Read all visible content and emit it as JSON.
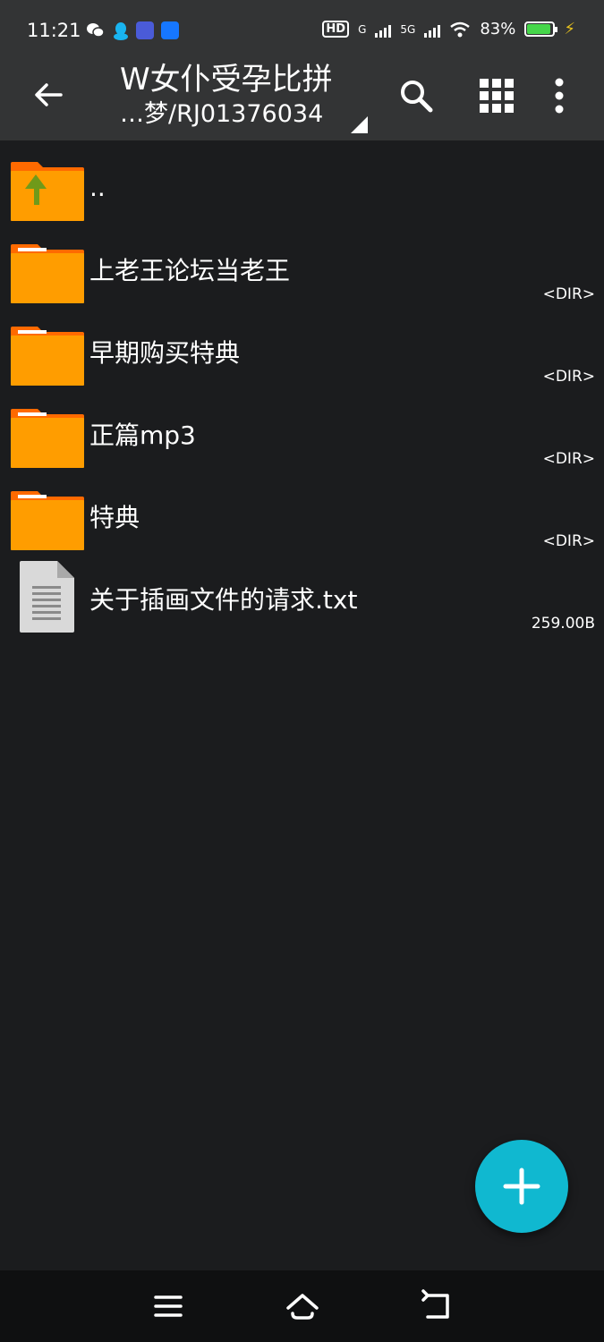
{
  "status_bar": {
    "time": "11:21",
    "right_text_hd": "HD",
    "network_a": "G",
    "network_b": "5G",
    "battery": "83%"
  },
  "toolbar": {
    "title": "W女仆受孕比拼",
    "subtitle": "…梦/RJ01376034"
  },
  "icons": {
    "back": "back-arrow-icon",
    "search": "search-icon",
    "grid": "grid-view-icon",
    "more": "more-vert-icon",
    "fab": "add-icon",
    "nav_menu": "menu-icon",
    "nav_home": "home-icon",
    "nav_back": "back-icon"
  },
  "colors": {
    "header": "#333435",
    "background": "#1b1c1e",
    "folder": "#ff9d00",
    "folder_tab": "#ff6a00",
    "fab": "#10b8d0",
    "battery": "#46d64a"
  },
  "files": [
    {
      "name": "..",
      "meta": "",
      "type": "parent"
    },
    {
      "name": "上老王论坛当老王",
      "meta": "<DIR>",
      "type": "folder"
    },
    {
      "name": "早期购买特典",
      "meta": "<DIR>",
      "type": "folder"
    },
    {
      "name": "正篇mp3",
      "meta": "<DIR>",
      "type": "folder"
    },
    {
      "name": "特典",
      "meta": "<DIR>",
      "type": "folder"
    },
    {
      "name": "关于插画文件的请求.txt",
      "meta": "259.00B",
      "type": "text"
    }
  ]
}
